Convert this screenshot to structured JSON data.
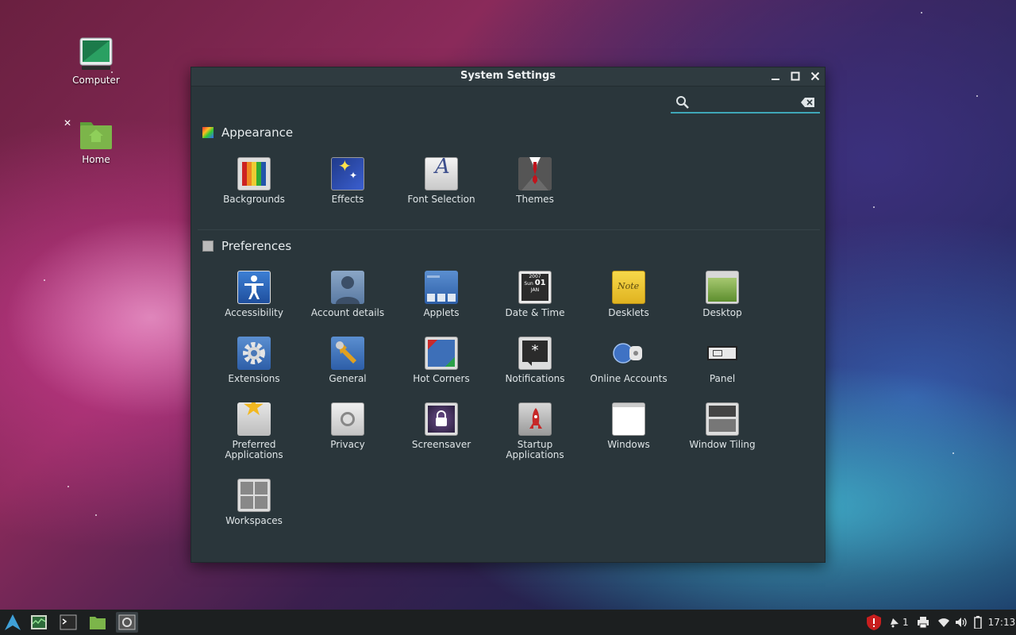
{
  "desktop": {
    "icons": [
      {
        "label": "Computer",
        "icon": "computer-icon"
      },
      {
        "label": "Home",
        "icon": "home-folder-icon"
      }
    ]
  },
  "window": {
    "title": "System Settings",
    "controls": {
      "minimize": "minimize-icon",
      "maximize": "maximize-icon",
      "close": "close-icon"
    },
    "search": {
      "value": "",
      "placeholder": "",
      "icon": "search-icon",
      "clear_icon": "backspace-clear-icon"
    },
    "sections": [
      {
        "title": "Appearance",
        "items": [
          {
            "label": "Backgrounds",
            "icon": "backgrounds-icon"
          },
          {
            "label": "Effects",
            "icon": "effects-icon"
          },
          {
            "label": "Font Selection",
            "icon": "font-selection-icon"
          },
          {
            "label": "Themes",
            "icon": "themes-icon"
          }
        ]
      },
      {
        "title": "Preferences",
        "items": [
          {
            "label": "Accessibility",
            "icon": "accessibility-icon"
          },
          {
            "label": "Account details",
            "icon": "account-details-icon"
          },
          {
            "label": "Applets",
            "icon": "applets-icon"
          },
          {
            "label": "Date & Time",
            "icon": "date-time-icon"
          },
          {
            "label": "Desklets",
            "icon": "desklets-icon"
          },
          {
            "label": "Desktop",
            "icon": "desktop-icon"
          },
          {
            "label": "Extensions",
            "icon": "extensions-icon"
          },
          {
            "label": "General",
            "icon": "general-icon"
          },
          {
            "label": "Hot Corners",
            "icon": "hot-corners-icon"
          },
          {
            "label": "Notifications",
            "icon": "notifications-icon"
          },
          {
            "label": "Online Accounts",
            "icon": "online-accounts-icon"
          },
          {
            "label": "Panel",
            "icon": "panel-icon"
          },
          {
            "label": "Preferred Applications",
            "icon": "preferred-applications-icon"
          },
          {
            "label": "Privacy",
            "icon": "privacy-icon"
          },
          {
            "label": "Screensaver",
            "icon": "screensaver-icon"
          },
          {
            "label": "Startup Applications",
            "icon": "startup-applications-icon"
          },
          {
            "label": "Windows",
            "icon": "windows-icon"
          },
          {
            "label": "Window Tiling",
            "icon": "window-tiling-icon"
          },
          {
            "label": "Workspaces",
            "icon": "workspaces-icon"
          }
        ]
      }
    ],
    "calendar_icon": {
      "year": "2007",
      "day": "Sun",
      "date": "01",
      "month": "JAN"
    },
    "desklets_icon_text": "Note"
  },
  "taskbar": {
    "launchers": [
      "menu-icon",
      "system-monitor-icon",
      "terminal-icon",
      "files-icon",
      "system-settings-icon"
    ],
    "tray": {
      "notification_count": "1",
      "clock": "17:13",
      "icons": [
        "shield-update-icon",
        "notifications-icon",
        "printer-icon",
        "wifi-icon",
        "volume-icon",
        "battery-icon"
      ]
    }
  },
  "colors": {
    "accent": "#3fa7b8",
    "window_bg": "#2a363b",
    "titlebar_bg": "#2f3b40",
    "taskbar_bg": "#1c1f20"
  }
}
